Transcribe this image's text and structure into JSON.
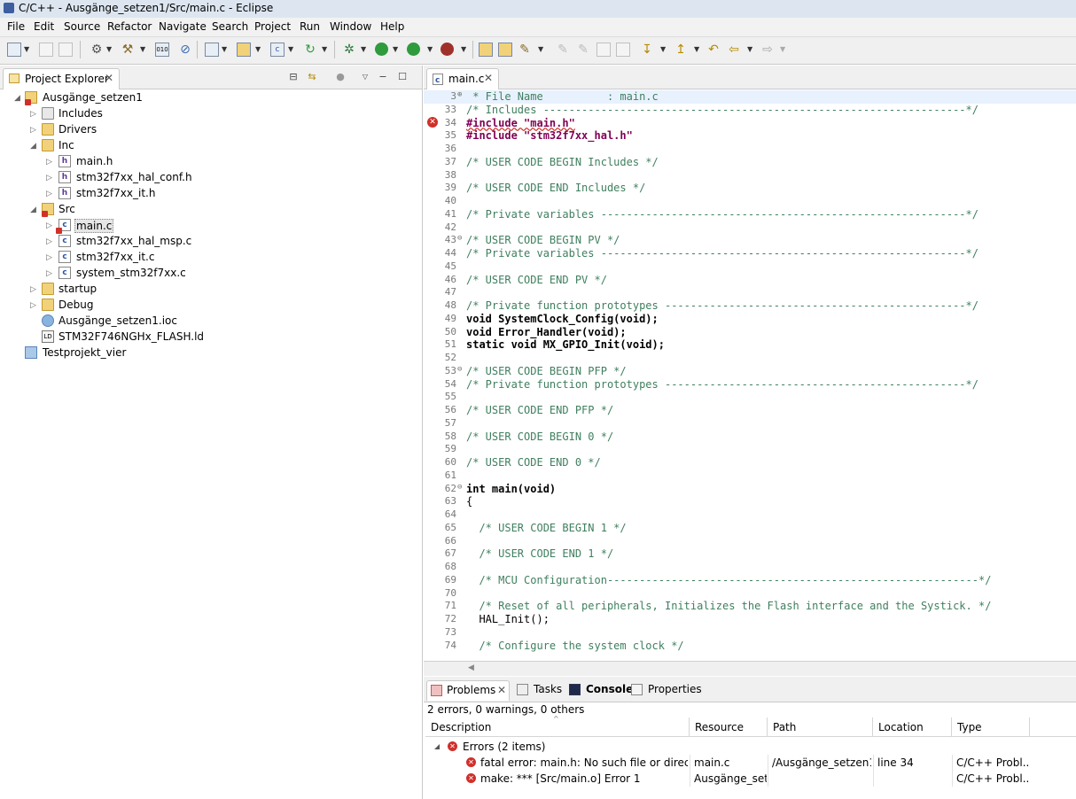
{
  "window": {
    "title": "C/C++ - Ausgänge_setzen1/Src/main.c - Eclipse"
  },
  "menu": [
    "File",
    "Edit",
    "Source",
    "Refactor",
    "Navigate",
    "Search",
    "Project",
    "Run",
    "Window",
    "Help"
  ],
  "explorer": {
    "title": "Project Explorer",
    "tree": [
      {
        "label": "Ausgänge_setzen1",
        "icon": "project-icon"
      },
      {
        "label": "Includes",
        "icon": "includes-icon"
      },
      {
        "label": "Drivers",
        "icon": "folder-icon"
      },
      {
        "label": "Inc",
        "icon": "folder-icon"
      },
      {
        "label": "main.h",
        "icon": "header-file-icon"
      },
      {
        "label": "stm32f7xx_hal_conf.h",
        "icon": "header-file-icon"
      },
      {
        "label": "stm32f7xx_it.h",
        "icon": "header-file-icon"
      },
      {
        "label": "Src",
        "icon": "source-folder-icon"
      },
      {
        "label": "main.c",
        "icon": "c-file-icon"
      },
      {
        "label": "stm32f7xx_hal_msp.c",
        "icon": "c-file-icon"
      },
      {
        "label": "stm32f7xx_it.c",
        "icon": "c-file-icon"
      },
      {
        "label": "system_stm32f7xx.c",
        "icon": "c-file-icon"
      },
      {
        "label": "startup",
        "icon": "folder-icon"
      },
      {
        "label": "Debug",
        "icon": "folder-icon"
      },
      {
        "label": "Ausgänge_setzen1.ioc",
        "icon": "ioc-file-icon"
      },
      {
        "label": "STM32F746NGHx_FLASH.ld",
        "icon": "linker-script-icon"
      },
      {
        "label": "Testprojekt_vier",
        "icon": "project-icon"
      }
    ]
  },
  "editor": {
    "tab": "main.c",
    "lines": [
      {
        "n": "3",
        "text": " * File Name          : main.c",
        "cls": "c-com"
      },
      {
        "n": "33",
        "text": "/* Includes ------------------------------------------------------------------*/",
        "cls": "c-com"
      },
      {
        "n": "34",
        "text": "#include \"main.h\"",
        "cls": "c-err"
      },
      {
        "n": "35",
        "text": "#include \"stm32f7xx_hal.h\"",
        "cls": "c-pp"
      },
      {
        "n": "36",
        "text": "",
        "cls": "c-pl"
      },
      {
        "n": "37",
        "text": "/* USER CODE BEGIN Includes */",
        "cls": "c-com"
      },
      {
        "n": "38",
        "text": "",
        "cls": "c-pl"
      },
      {
        "n": "39",
        "text": "/* USER CODE END Includes */",
        "cls": "c-com"
      },
      {
        "n": "40",
        "text": "",
        "cls": "c-pl"
      },
      {
        "n": "41",
        "text": "/* Private variables ---------------------------------------------------------*/",
        "cls": "c-com"
      },
      {
        "n": "42",
        "text": "",
        "cls": "c-pl"
      },
      {
        "n": "43",
        "text": "/* USER CODE BEGIN PV */",
        "cls": "c-com"
      },
      {
        "n": "44",
        "text": "/* Private variables ---------------------------------------------------------*/",
        "cls": "c-com"
      },
      {
        "n": "45",
        "text": "",
        "cls": "c-pl"
      },
      {
        "n": "46",
        "text": "/* USER CODE END PV */",
        "cls": "c-com"
      },
      {
        "n": "47",
        "text": "",
        "cls": "c-pl"
      },
      {
        "n": "48",
        "text": "/* Private function prototypes -----------------------------------------------*/",
        "cls": "c-com"
      },
      {
        "n": "49",
        "text": "void SystemClock_Config(void);",
        "cls": "c-fn"
      },
      {
        "n": "50",
        "text": "void Error_Handler(void);",
        "cls": "c-fn"
      },
      {
        "n": "51",
        "text": "static void MX_GPIO_Init(void);",
        "cls": "c-fn"
      },
      {
        "n": "52",
        "text": "",
        "cls": "c-pl"
      },
      {
        "n": "53",
        "text": "/* USER CODE BEGIN PFP */",
        "cls": "c-com"
      },
      {
        "n": "54",
        "text": "/* Private function prototypes -----------------------------------------------*/",
        "cls": "c-com"
      },
      {
        "n": "55",
        "text": "",
        "cls": "c-pl"
      },
      {
        "n": "56",
        "text": "/* USER CODE END PFP */",
        "cls": "c-com"
      },
      {
        "n": "57",
        "text": "",
        "cls": "c-pl"
      },
      {
        "n": "58",
        "text": "/* USER CODE BEGIN 0 */",
        "cls": "c-com"
      },
      {
        "n": "59",
        "text": "",
        "cls": "c-pl"
      },
      {
        "n": "60",
        "text": "/* USER CODE END 0 */",
        "cls": "c-com"
      },
      {
        "n": "61",
        "text": "",
        "cls": "c-pl"
      },
      {
        "n": "62",
        "text": "int main(void)",
        "cls": "c-fn"
      },
      {
        "n": "63",
        "text": "{",
        "cls": "c-pl"
      },
      {
        "n": "64",
        "text": "",
        "cls": "c-pl"
      },
      {
        "n": "65",
        "text": "  /* USER CODE BEGIN 1 */",
        "cls": "c-com"
      },
      {
        "n": "66",
        "text": "",
        "cls": "c-pl"
      },
      {
        "n": "67",
        "text": "  /* USER CODE END 1 */",
        "cls": "c-com"
      },
      {
        "n": "68",
        "text": "",
        "cls": "c-pl"
      },
      {
        "n": "69",
        "text": "  /* MCU Configuration----------------------------------------------------------*/",
        "cls": "c-com"
      },
      {
        "n": "70",
        "text": "",
        "cls": "c-pl"
      },
      {
        "n": "71",
        "text": "  /* Reset of all peripherals, Initializes the Flash interface and the Systick. */",
        "cls": "c-com"
      },
      {
        "n": "72",
        "text": "  HAL_Init();",
        "cls": "c-pl"
      },
      {
        "n": "73",
        "text": "",
        "cls": "c-pl"
      },
      {
        "n": "74",
        "text": "  /* Configure the system clock */",
        "cls": "c-com"
      }
    ]
  },
  "problems": {
    "tabs": [
      "Problems",
      "Tasks",
      "Console",
      "Properties"
    ],
    "summary": "2 errors, 0 warnings, 0 others",
    "columns": [
      "Description",
      "Resource",
      "Path",
      "Location",
      "Type"
    ],
    "group": "Errors (2 items)",
    "rows": [
      {
        "description": "fatal error: main.h: No such file or directory",
        "resource": "main.c",
        "path": "/Ausgänge_setzen1...",
        "location": "line 34",
        "type": "C/C++ Probl..."
      },
      {
        "description": "make: *** [Src/main.o] Error 1",
        "resource": "Ausgänge_set...",
        "path": "",
        "location": "",
        "type": "C/C++ Probl..."
      }
    ]
  }
}
